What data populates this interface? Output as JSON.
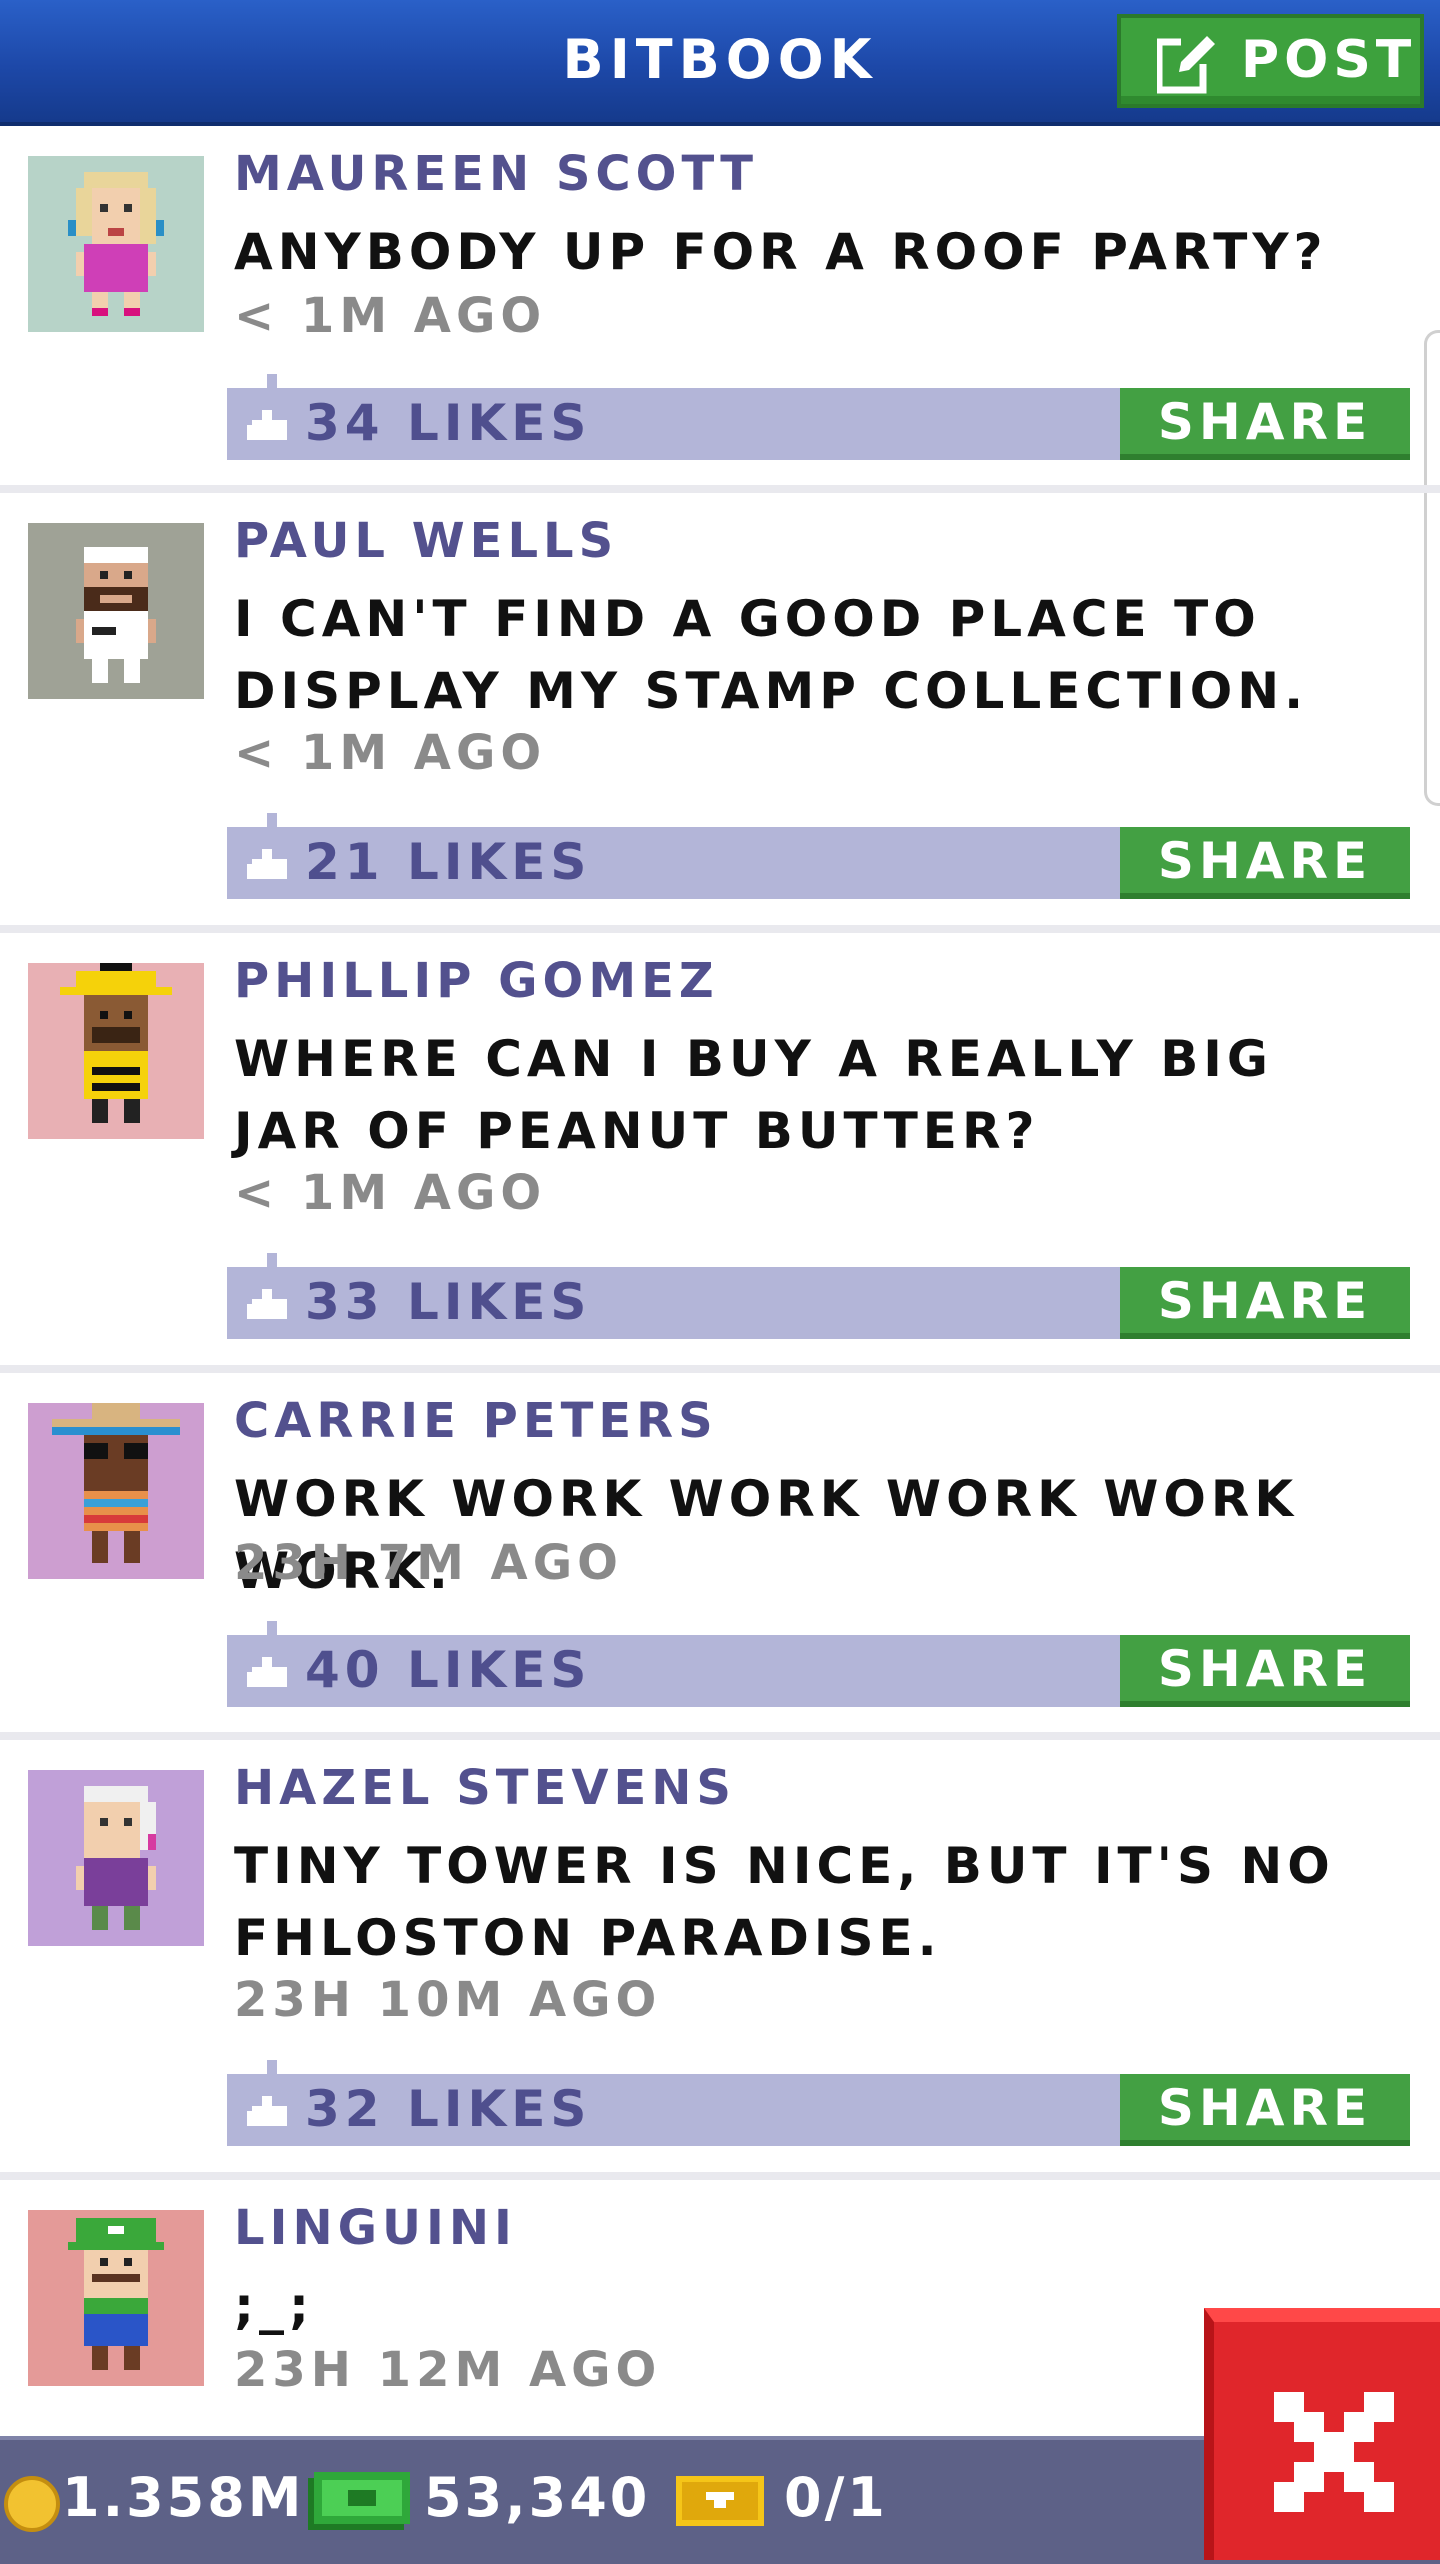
{
  "header": {
    "title": "BITBOOK",
    "post_label": "POST"
  },
  "posts": [
    {
      "name": "MAUREEN SCOTT",
      "message": "ANYBODY UP FOR A ROOF PARTY?",
      "time": "< 1M AGO",
      "likes": "34 LIKES",
      "share_label": "SHARE",
      "avatar_bg": "#b7d3c8"
    },
    {
      "name": "PAUL WELLS",
      "message": "I CAN'T FIND A GOOD PLACE TO DISPLAY MY STAMP COLLECTION.",
      "time": "< 1M AGO",
      "likes": "21 LIKES",
      "share_label": "SHARE",
      "avatar_bg": "#9fa296"
    },
    {
      "name": "PHILLIP GOMEZ",
      "message": "WHERE CAN I BUY A REALLY BIG JAR OF PEANUT BUTTER?",
      "time": "< 1M AGO",
      "likes": "33 LIKES",
      "share_label": "SHARE",
      "avatar_bg": "#e8b0b4"
    },
    {
      "name": "CARRIE PETERS",
      "message": "WORK WORK WORK WORK WORK WORK.",
      "time": "23H 7M AGO",
      "likes": "40 LIKES",
      "share_label": "SHARE",
      "avatar_bg": "#cd9ed0"
    },
    {
      "name": "HAZEL STEVENS",
      "message": "TINY TOWER IS NICE, BUT IT'S NO FHLOSTON PARADISE.",
      "time": "23H 10M AGO",
      "likes": "32 LIKES",
      "share_label": "SHARE",
      "avatar_bg": "#c0a0d8"
    },
    {
      "name": "LINGUINI",
      "message": ";_;",
      "time": "23H 12M AGO",
      "avatar_bg": "#e49a98"
    }
  ],
  "footer": {
    "coins": "1.358M",
    "bux": "53,340",
    "tickets": "0/1"
  },
  "colors": {
    "header_blue": "#1d48a8",
    "accent_green": "#43a043",
    "name_purple": "#53518e",
    "likes_bar": "#b3b5d8",
    "footer_bg": "#5d6187",
    "close_red": "#e0262b"
  },
  "icons": {
    "post": "compose-icon",
    "like": "thumb-up-icon",
    "coin": "coin-icon",
    "bux": "bux-icon",
    "ticket": "ticket-icon",
    "close": "close-icon"
  }
}
